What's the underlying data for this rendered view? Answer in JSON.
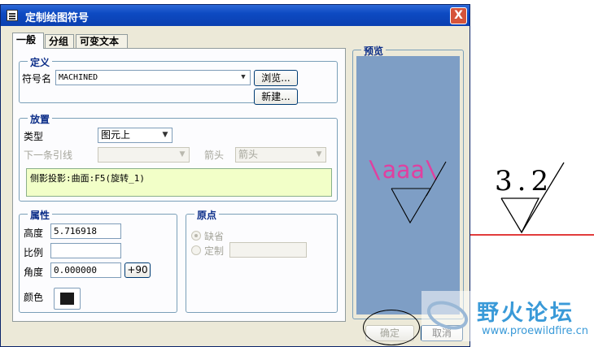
{
  "dialog": {
    "title": "定制绘图符号",
    "close_label": "X",
    "tabs": [
      {
        "label": "一般",
        "active": true
      },
      {
        "label": "分组",
        "active": false
      },
      {
        "label": "可变文本",
        "active": false
      }
    ],
    "definition": {
      "legend": "定义",
      "symbol_name_label": "符号名",
      "symbol_name_value": "MACHINED",
      "browse_button": "浏览...",
      "new_button": "新建..."
    },
    "placement": {
      "legend": "放置",
      "type_label": "类型",
      "type_value": "图元上",
      "next_leader_label": "下一条引线",
      "next_leader_value": "",
      "arrow_label": "箭头",
      "arrow_value": "箭头",
      "reference_text": "侧影投影:曲面:F5(旋转_1)"
    },
    "properties": {
      "legend": "属性",
      "height_label": "高度",
      "height_value": "5.716918",
      "scale_label": "比例",
      "scale_value": "",
      "angle_label": "角度",
      "angle_value": "0.000000",
      "plus90_button": "+90",
      "color_label": "颜色",
      "color_value": "#1a1a1a"
    },
    "origin": {
      "legend": "原点",
      "default_label": "缺省",
      "custom_label": "定制",
      "custom_value": ""
    },
    "preview": {
      "legend": "预览",
      "symbol_text": "\\aaa\\",
      "background": "#7e9ec5",
      "text_color": "#e040a0"
    },
    "ok_button": "确定",
    "cancel_button": "取消"
  },
  "canvas": {
    "roughness_value": "3.2",
    "line_color": "#e23c3c"
  },
  "watermark": {
    "name": "野火论坛",
    "url": "www.proewildfire.cn"
  }
}
